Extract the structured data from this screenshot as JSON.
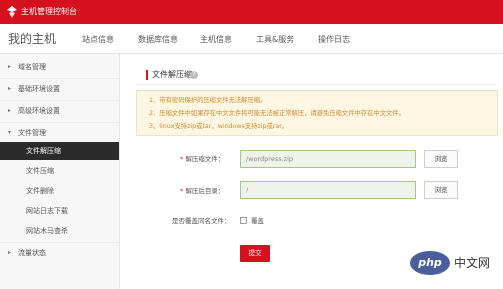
{
  "app": {
    "title": "主机管理控制台",
    "brand_color": "#d4111d",
    "logo_icon": "brand-logo-icon"
  },
  "subnav": {
    "host_title": "我的主机",
    "tabs": [
      "站点信息",
      "数据库信息",
      "主机信息",
      "工具&服务",
      "操作日志"
    ]
  },
  "sidebar": {
    "items": [
      {
        "label": "域名管理",
        "arrow": "▸"
      },
      {
        "label": "基础环境设置",
        "arrow": "▸"
      },
      {
        "label": "高级环境设置",
        "arrow": "▸"
      },
      {
        "label": "文件管理",
        "arrow": "▾"
      },
      {
        "label": "文件解压缩",
        "active": true
      },
      {
        "label": "文件压缩"
      },
      {
        "label": "文件删除"
      },
      {
        "label": "网站日志下载"
      },
      {
        "label": "网站木马查杀"
      },
      {
        "label": "流量状态",
        "arrow": "▸"
      }
    ]
  },
  "main": {
    "section_title": "文件解压缩",
    "help_icon": "?",
    "notice": {
      "lines": [
        "1、带有密码保护的压缩文件无法解压缩。",
        "2、压缩文件中如果存在中文文件将可能无法被正常解压，请避免压缩文件中存在中文文件。",
        "3、linux支持zip或tar，windows支持zip或rar。"
      ],
      "color": "#d18b2c"
    },
    "form": {
      "required_mark": "*",
      "archive_label": "解压缩文件：",
      "archive_value": "/wordpress.zip",
      "target_label": "解压后目录：",
      "target_value": "/",
      "browse_label": "浏览",
      "overwrite_label": "是否覆盖同名文件：",
      "overwrite_option": "覆盖",
      "overwrite_checked": false,
      "submit_label": "提交"
    }
  },
  "watermark": {
    "badge": "php",
    "text": "中文网"
  }
}
